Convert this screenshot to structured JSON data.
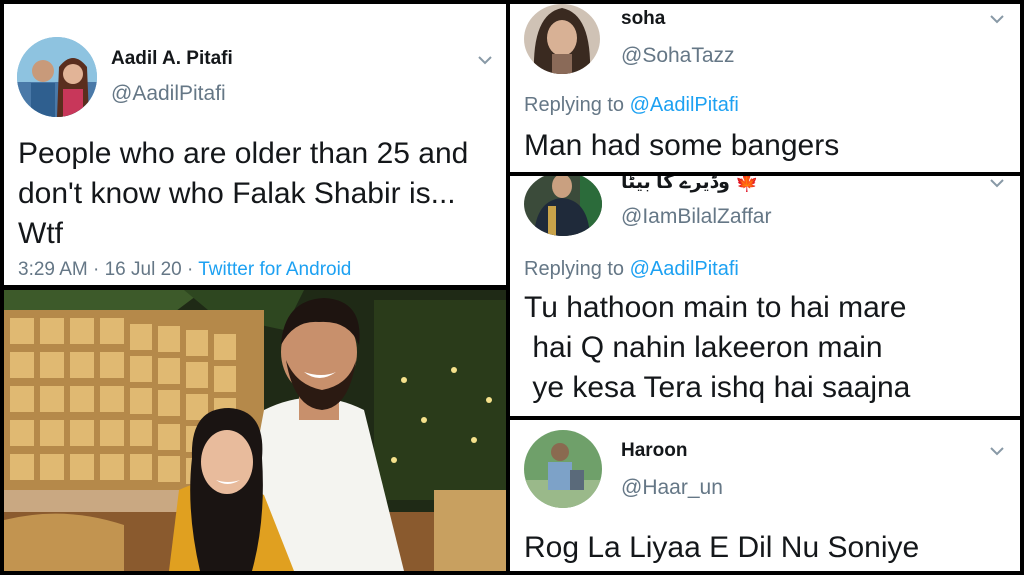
{
  "tweets": {
    "main": {
      "name": "Aadil A. Pitafi",
      "handle": "@AadilPitafi",
      "text": "People who are older than 25 and\ndon't know who Falak Shabir is...\nWtf",
      "time": "3:29 AM · 16 Jul 20 · ",
      "source": "Twitter for Android"
    },
    "soha": {
      "name": "soha",
      "handle": "@SohaTazz",
      "replying_prefix": "Replying to ",
      "replying_to": "@AadilPitafi",
      "text": "Man had some bangers"
    },
    "bilal": {
      "name": "وڈیرے کا بیٹا",
      "flag": "🍁",
      "handle": "@IamBilalZaffar",
      "replying_prefix": "Replying to ",
      "replying_to": "@AadilPitafi",
      "text": "Tu hathoon main to hai mare\n hai Q nahin lakeeron main\n ye kesa Tera ishq hai saajna"
    },
    "haroon": {
      "name": "Haroon",
      "handle": "@Haar_un",
      "text": "Rog La Liyaa E Dil Nu Soniye"
    }
  },
  "icons": {
    "chevron": "chevron-down-icon",
    "photo": "couple-photo"
  },
  "colors": {
    "link": "#1da1f2",
    "secondary_text": "#657786",
    "primary_text": "#14171a"
  }
}
